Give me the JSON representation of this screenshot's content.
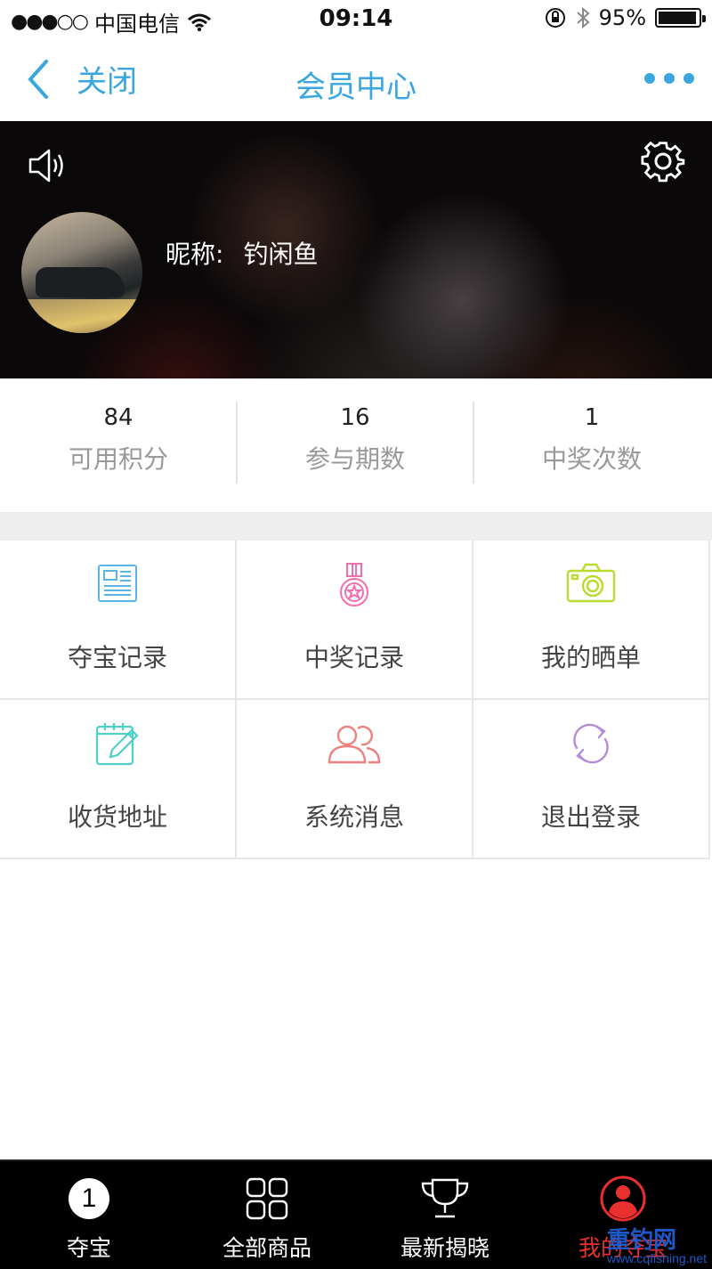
{
  "status_bar": {
    "carrier": "中国电信",
    "signal": "●●●○○",
    "time": "09:14",
    "battery": "95%"
  },
  "nav": {
    "back_label": "关闭",
    "title": "会员中心",
    "more_icon": "more-dots-icon",
    "accent_color": "#3aa6e0"
  },
  "profile": {
    "nickname_label": "昵称:",
    "nickname": "钓闲鱼"
  },
  "stats": [
    {
      "value": "84",
      "label": "可用积分"
    },
    {
      "value": "16",
      "label": "参与期数"
    },
    {
      "value": "1",
      "label": "中奖次数"
    }
  ],
  "menu": [
    {
      "label": "夺宝记录",
      "icon": "record-list-icon",
      "color": "#5ab4e6"
    },
    {
      "label": "中奖记录",
      "icon": "medal-icon",
      "color": "#f06fb0"
    },
    {
      "label": "我的晒单",
      "icon": "camera-icon",
      "color": "#b8db2e"
    },
    {
      "label": "收货地址",
      "icon": "notepad-edit-icon",
      "color": "#4ed0c8"
    },
    {
      "label": "系统消息",
      "icon": "users-icon",
      "color": "#ee8080"
    },
    {
      "label": "退出登录",
      "icon": "refresh-icon",
      "color": "#b58ad8"
    }
  ],
  "tabbar": [
    {
      "label": "夺宝",
      "icon": "number-one-icon",
      "badge": "1"
    },
    {
      "label": "全部商品",
      "icon": "grid-icon"
    },
    {
      "label": "最新揭晓",
      "icon": "trophy-icon"
    },
    {
      "label": "我的夺宝",
      "icon": "user-profile-icon",
      "active_color": "#e8312e"
    }
  ],
  "watermark": {
    "text": "重钓网",
    "url": "www.cqfishing.net"
  }
}
